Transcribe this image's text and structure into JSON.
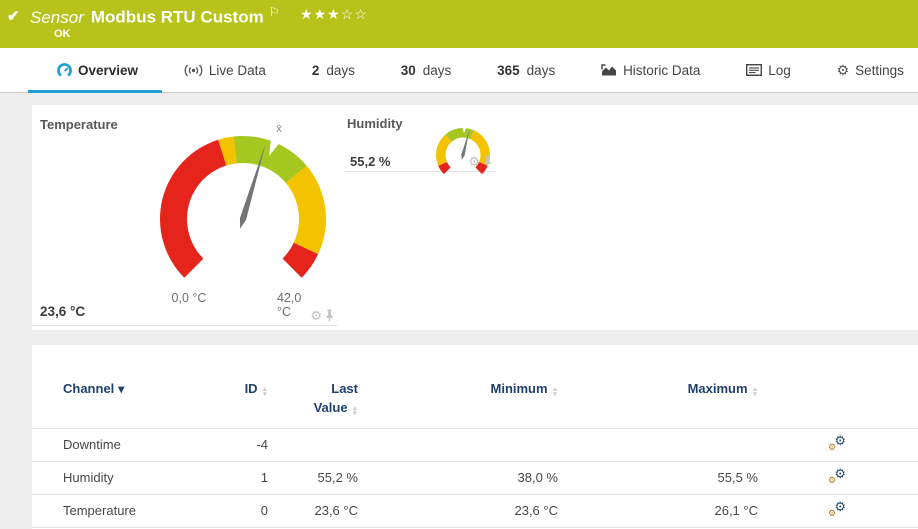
{
  "colors": {
    "header_bg": "#b7c31a",
    "accent": "#1b9fd9",
    "gauge_red": "#e5241c",
    "gauge_yellow": "#f4c300",
    "gauge_green": "#a6c71f",
    "needle": "#747474",
    "table_header_text": "#20416f"
  },
  "header": {
    "status_icon": "✔",
    "kind": "Sensor",
    "title": "Modbus RTU Custom",
    "flag_icon": "⚐",
    "rating_filled": "★★★",
    "rating_empty": "☆☆",
    "status": "OK"
  },
  "tabs": {
    "items": [
      {
        "label": "Overview",
        "active": true
      },
      {
        "label": "Live Data"
      },
      {
        "num": "2",
        "label": "days"
      },
      {
        "num": "30",
        "label": "days"
      },
      {
        "num": "365",
        "label": "days"
      },
      {
        "label": "Historic Data"
      },
      {
        "label": "Log"
      },
      {
        "label": "Settings"
      }
    ]
  },
  "gauges": {
    "temperature": {
      "title": "Temperature",
      "value_label": "23,6 °C",
      "min_label": "0,0 °C",
      "max_label": "42,0 °C",
      "scale_min": 0,
      "scale_max": 42,
      "value": 23.6,
      "average": 24.5,
      "average_marker": "x̄",
      "segments": [
        {
          "from": 0,
          "to": 18.3,
          "color": "#e5241c"
        },
        {
          "from": 18.3,
          "to": 20,
          "color": "#f4c300"
        },
        {
          "from": 20,
          "to": 28.8,
          "color": "#a6c71f"
        },
        {
          "from": 28.8,
          "to": 38.9,
          "color": "#f4c300"
        },
        {
          "from": 38.9,
          "to": 42,
          "color": "#e5241c"
        }
      ]
    },
    "humidity": {
      "title": "Humidity",
      "value_label": "55,2 %",
      "scale_min": 0,
      "scale_max": 100,
      "value": 55.2,
      "average": 51,
      "segments": [
        {
          "from": 0,
          "to": 8,
          "color": "#e5241c"
        },
        {
          "from": 8,
          "to": 35,
          "color": "#f4c300"
        },
        {
          "from": 35,
          "to": 59,
          "color": "#a6c71f"
        },
        {
          "from": 59,
          "to": 92,
          "color": "#f4c300"
        },
        {
          "from": 92,
          "to": 100,
          "color": "#e5241c"
        }
      ]
    }
  },
  "channels": {
    "col_channel": "Channel",
    "col_id": "ID",
    "col_last_1": "Last",
    "col_last_2": "Value",
    "col_min": "Minimum",
    "col_max": "Maximum",
    "rows": [
      {
        "channel": "Downtime",
        "id": "-4",
        "last": "",
        "min": "",
        "max": ""
      },
      {
        "channel": "Humidity",
        "id": "1",
        "last": "55,2 %",
        "min": "38,0 %",
        "max": "55,5 %"
      },
      {
        "channel": "Temperature",
        "id": "0",
        "last": "23,6 °C",
        "min": "23,6 °C",
        "max": "26,1 °C"
      }
    ]
  }
}
